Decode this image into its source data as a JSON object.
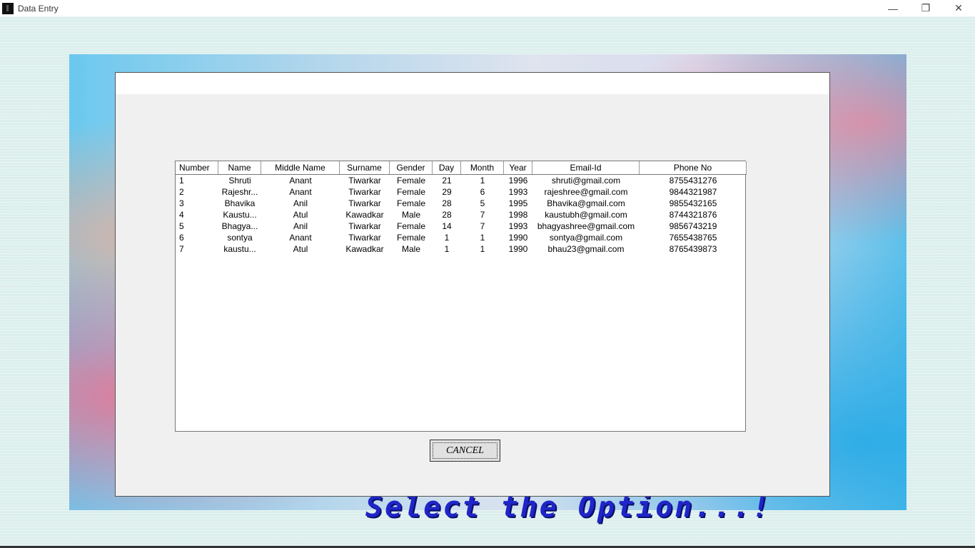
{
  "window": {
    "title": "Data Entry",
    "minimize_glyph": "—",
    "restore_glyph": "❐",
    "close_glyph": "✕"
  },
  "background": {
    "bottom_banner": "Select the Option...!"
  },
  "table": {
    "columns": [
      "Number",
      "Name",
      "Middle Name",
      "Surname",
      "Gender",
      "Day",
      "Month",
      "Year",
      "Email-Id",
      "Phone No"
    ],
    "rows": [
      [
        "1",
        "Shruti",
        "Anant",
        "Tiwarkar",
        "Female",
        "21",
        "1",
        "1996",
        "shruti@gmail.com",
        "8755431276"
      ],
      [
        "2",
        "Rajeshr...",
        "Anant",
        "Tiwarkar",
        "Female",
        "29",
        "6",
        "1993",
        "rajeshree@gmail.com",
        "9844321987"
      ],
      [
        "3",
        "Bhavika",
        "Anil",
        "Tiwarkar",
        "Female",
        "28",
        "5",
        "1995",
        "Bhavika@gmail.com",
        "9855432165"
      ],
      [
        "4",
        "Kaustu...",
        "Atul",
        "Kawadkar",
        "Male",
        "28",
        "7",
        "1998",
        "kaustubh@gmail.com",
        "8744321876"
      ],
      [
        "5",
        "Bhagya...",
        "Anil",
        "Tiwarkar",
        "Female",
        "14",
        "7",
        "1993",
        "bhagyashree@gmail.com",
        "9856743219"
      ],
      [
        "6",
        "sontya",
        "Anant",
        "Tiwarkar",
        "Female",
        "1",
        "1",
        "1990",
        "sontya@gmail.com",
        "7655438765"
      ],
      [
        "7",
        "kaustu...",
        "Atul",
        "Kawadkar",
        "Male",
        "1",
        "1",
        "1990",
        "bhau23@gmail.com",
        "8765439873"
      ]
    ]
  },
  "buttons": {
    "cancel_label": "CANCEL"
  }
}
